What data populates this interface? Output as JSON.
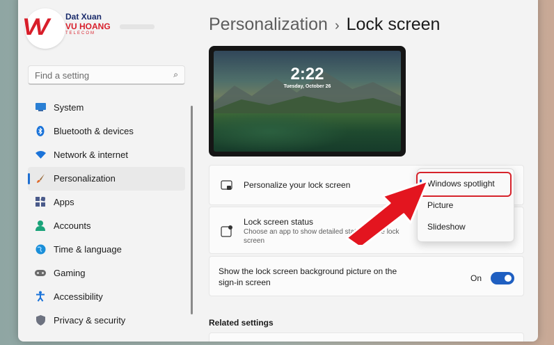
{
  "logo": {
    "name": "Dat Xuan",
    "brand": "VU HOANG",
    "sub": "TELECOM"
  },
  "search": {
    "placeholder": "Find a setting"
  },
  "sidebar": {
    "items": [
      {
        "label": "System",
        "icon": "monitor-icon",
        "active": false
      },
      {
        "label": "Bluetooth & devices",
        "icon": "bluetooth-icon",
        "active": false
      },
      {
        "label": "Network & internet",
        "icon": "wifi-icon",
        "active": false
      },
      {
        "label": "Personalization",
        "icon": "brush-icon",
        "active": true
      },
      {
        "label": "Apps",
        "icon": "apps-icon",
        "active": false
      },
      {
        "label": "Accounts",
        "icon": "user-icon",
        "active": false
      },
      {
        "label": "Time & language",
        "icon": "globe-icon",
        "active": false
      },
      {
        "label": "Gaming",
        "icon": "gamepad-icon",
        "active": false
      },
      {
        "label": "Accessibility",
        "icon": "accessibility-icon",
        "active": false
      },
      {
        "label": "Privacy & security",
        "icon": "shield-icon",
        "active": false
      }
    ]
  },
  "header": {
    "parent": "Personalization",
    "separator": "›",
    "current": "Lock screen"
  },
  "preview": {
    "time": "2:22",
    "date": "Tuesday, October 26"
  },
  "personalize": {
    "title": "Personalize your lock screen"
  },
  "status": {
    "title": "Lock screen status",
    "desc": "Choose an app to show detailed status on the lock screen"
  },
  "signin": {
    "title": "Show the lock screen background picture on the sign-in screen",
    "state": "On"
  },
  "dropdown": {
    "options": [
      "Windows spotlight",
      "Picture",
      "Slideshow"
    ],
    "selected": "Windows spotlight"
  },
  "related": {
    "title": "Related settings"
  },
  "colors": {
    "accent": "#1f5fc1",
    "highlight": "#d6232b",
    "arrow": "#e3151f"
  }
}
